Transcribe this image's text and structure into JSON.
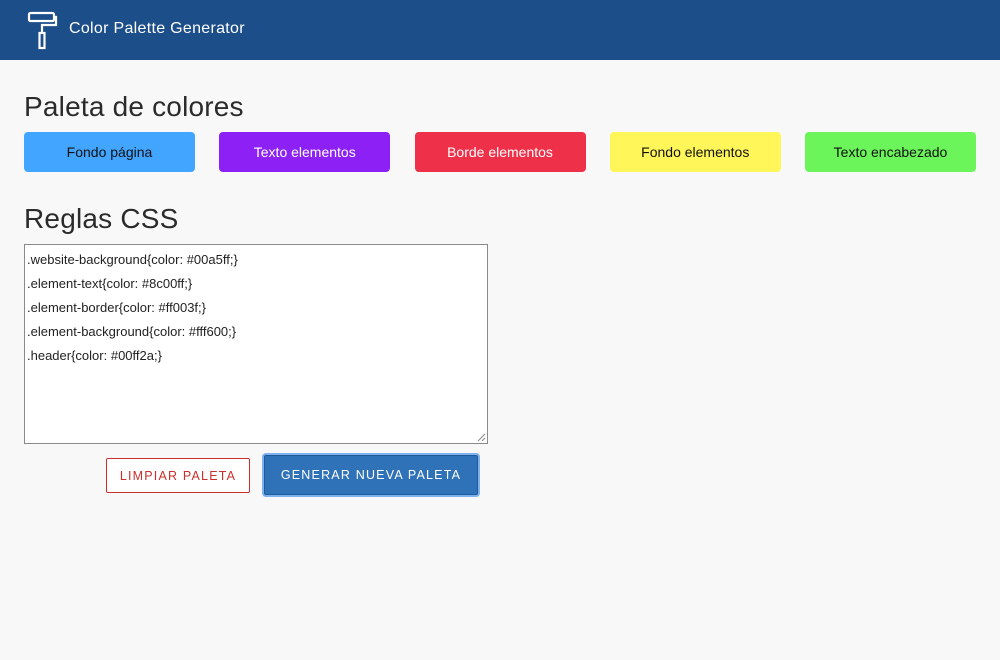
{
  "header": {
    "app_title": "Color Palette Generator",
    "logo_icon": "paint-roller-icon",
    "background": "#1c4e8a"
  },
  "palette": {
    "title": "Paleta de colores",
    "swatches": [
      {
        "label": "Fondo página",
        "background": "#42a5ff",
        "text_color": "#111111"
      },
      {
        "label": "Texto elementos",
        "background": "#8c20f5",
        "text_color": "#ffffff"
      },
      {
        "label": "Borde elementos",
        "background": "#ee3049",
        "text_color": "#ffffff"
      },
      {
        "label": "Fondo elementos",
        "background": "#fff65a",
        "text_color": "#111111"
      },
      {
        "label": "Texto encabezado",
        "background": "#6bf55a",
        "text_color": "#111111"
      }
    ]
  },
  "css_rules": {
    "title": "Reglas CSS",
    "content": ".website-background{color: #00a5ff;}\n.element-text{color: #8c00ff;}\n.element-border{color: #ff003f;}\n.element-background{color: #fff600;}\n.header{color: #00ff2a;}"
  },
  "actions": {
    "clear_label": "Limpiar paleta",
    "generate_label": "Generar nueva paleta"
  }
}
